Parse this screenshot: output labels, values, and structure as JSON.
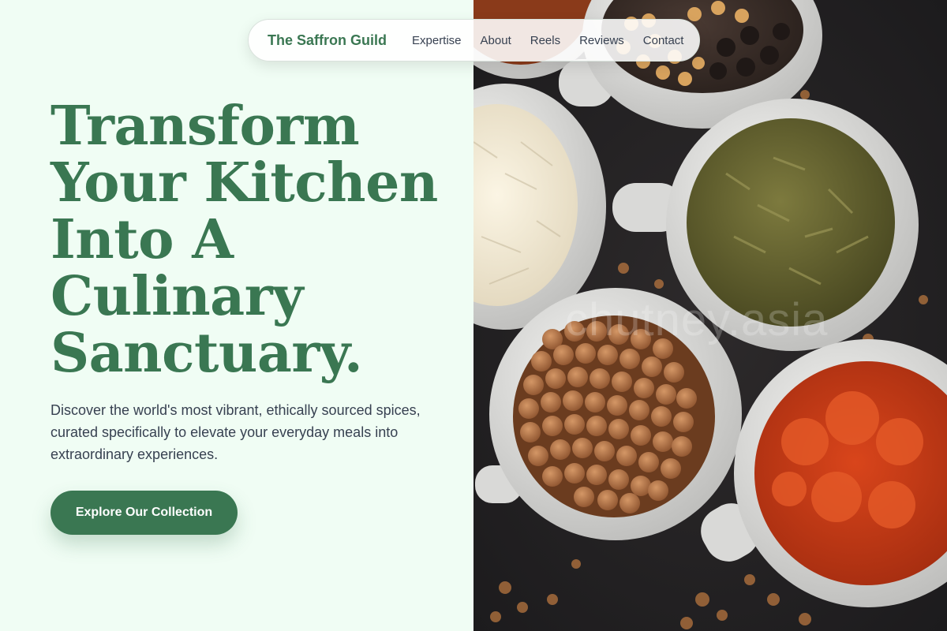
{
  "nav": {
    "brand": "The Saffron Guild",
    "links": [
      "Expertise",
      "About",
      "Reels",
      "Reviews",
      "Contact"
    ]
  },
  "hero": {
    "headline_lines": [
      "Transform",
      "Your Kitchen",
      "Into A",
      "Culinary",
      "Sanctuary."
    ],
    "subtext": "Discover the world's most vibrant, ethically sourced spices, curated specifically to elevate your everyday meals into extraordinary experiences.",
    "cta_label": "Explore Our Collection"
  },
  "image": {
    "subject": "bowls of spices: peppercorns, grated coconut, dried herbs, coriander seeds, red chili powder",
    "watermark": "chutney.asia"
  },
  "colors": {
    "accent": "#3a7752",
    "background": "#f0fdf4",
    "body_text": "#374151"
  }
}
